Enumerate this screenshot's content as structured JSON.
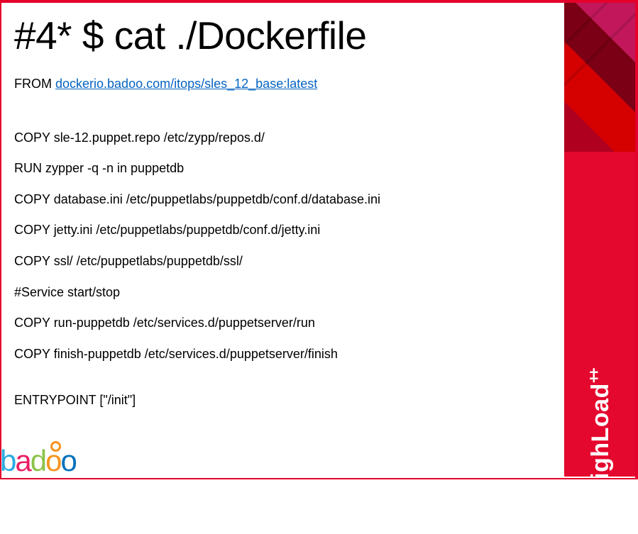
{
  "title": "#4* $ cat ./Dockerfile",
  "from_prefix": "FROM ",
  "from_link": "dockerio.badoo.com/itops/sles_12_base:latest",
  "lines": [
    "COPY sle-12.puppet.repo  /etc/zypp/repos.d/",
    "RUN zypper  -q -n in puppetdb",
    "COPY database.ini /etc/puppetlabs/puppetdb/conf.d/database.ini",
    "COPY jetty.ini /etc/puppetlabs/puppetdb/conf.d/jetty.ini",
    "COPY ssl/ /etc/puppetlabs/puppetdb/ssl/",
    "#Service start/stop",
    "COPY run-puppetdb  /etc/services.d/puppetserver/run",
    "COPY finish-puppetdb  /etc/services.d/puppetserver/finish"
  ],
  "entrypoint": "ENTRYPOINT  [\"/init\"]",
  "brand": "HighLoad",
  "brand_plus": "++",
  "footer_logo": {
    "b": "b",
    "a": "a",
    "d": "d",
    "o1": "o",
    "o2": "o"
  }
}
